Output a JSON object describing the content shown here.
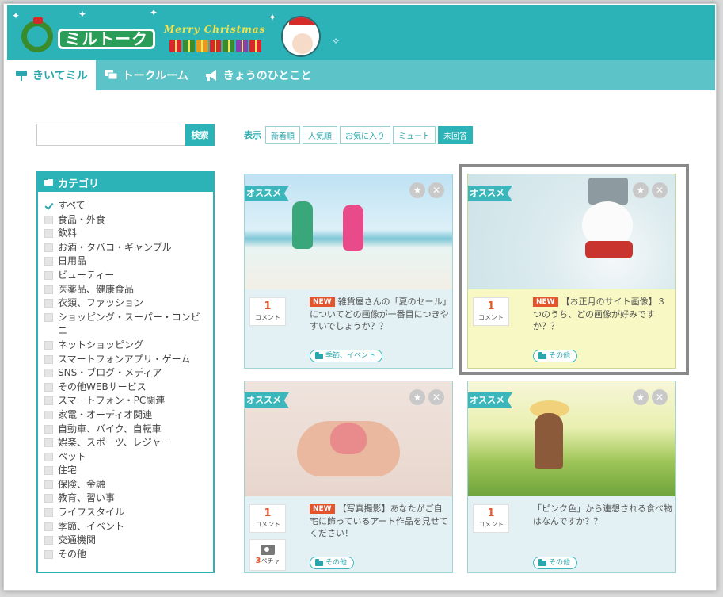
{
  "header": {
    "logo_text": "ミルトーク",
    "banner_text": "Merry Christmas"
  },
  "nav": {
    "tabs": [
      {
        "label": "きいてミル",
        "icon": "pin-icon",
        "active": true
      },
      {
        "label": "トークルーム",
        "icon": "chat-icon",
        "active": false
      },
      {
        "label": "きょうのひとこと",
        "icon": "megaphone-icon",
        "active": false
      }
    ]
  },
  "search": {
    "placeholder": "",
    "button_label": "検索"
  },
  "category": {
    "title": "カテゴリ",
    "items": [
      {
        "label": "すべて",
        "checked": true
      },
      {
        "label": "食品・外食",
        "checked": false
      },
      {
        "label": "飲料",
        "checked": false
      },
      {
        "label": "お酒・タバコ・ギャンブル",
        "checked": false
      },
      {
        "label": "日用品",
        "checked": false
      },
      {
        "label": "ビューティー",
        "checked": false
      },
      {
        "label": "医薬品、健康食品",
        "checked": false
      },
      {
        "label": "衣類、ファッション",
        "checked": false
      },
      {
        "label": "ショッピング・スーパー・コンビニ",
        "checked": false
      },
      {
        "label": "ネットショッピング",
        "checked": false
      },
      {
        "label": "スマートフォンアプリ・ゲーム",
        "checked": false
      },
      {
        "label": "SNS・ブログ・メディア",
        "checked": false
      },
      {
        "label": "その他WEBサービス",
        "checked": false
      },
      {
        "label": "スマートフォン・PC関連",
        "checked": false
      },
      {
        "label": "家電・オーディオ関連",
        "checked": false
      },
      {
        "label": "自動車、バイク、自転車",
        "checked": false
      },
      {
        "label": "娯楽、スポーツ、レジャー",
        "checked": false
      },
      {
        "label": "ペット",
        "checked": false
      },
      {
        "label": "住宅",
        "checked": false
      },
      {
        "label": "保険、金融",
        "checked": false
      },
      {
        "label": "教育、習い事",
        "checked": false
      },
      {
        "label": "ライフスタイル",
        "checked": false
      },
      {
        "label": "季節、イベント",
        "checked": false
      },
      {
        "label": "交通機関",
        "checked": false
      },
      {
        "label": "その他",
        "checked": false
      }
    ]
  },
  "filter": {
    "label": "表示",
    "buttons": [
      {
        "label": "新着順",
        "active": false
      },
      {
        "label": "人気順",
        "active": false
      },
      {
        "label": "お気に入り",
        "active": false
      },
      {
        "label": "ミュート",
        "active": false
      },
      {
        "label": "未回答",
        "active": true
      }
    ]
  },
  "cards": [
    {
      "ribbon": "オススメ",
      "comment_count": "1",
      "comment_label": "コメント",
      "is_new": true,
      "new_label": "NEW",
      "title": "雑貨屋さんの「夏のセール」についてどの画像が一番目につきやすいでしょうか？？",
      "tag": "季節、イベント",
      "image": "beach-jump-photo",
      "highlighted": false
    },
    {
      "ribbon": "オススメ",
      "comment_count": "1",
      "comment_label": "コメント",
      "is_new": true,
      "new_label": "NEW",
      "title": "【お正月のサイト画像】３つのうち、どの画像が好みですか？？",
      "tag": "その他",
      "image": "snowman-photo",
      "highlighted": true
    },
    {
      "ribbon": "オススメ",
      "comment_count": "1",
      "comment_label": "コメント",
      "is_new": true,
      "new_label": "NEW",
      "title": "【写真撮影】あなたがご自宅に飾っているアート作品を見せてください！",
      "tag": "その他",
      "image": "hands-heart-photo",
      "photo_count": "3",
      "photo_label": "ペチャ",
      "highlighted": false
    },
    {
      "ribbon": "オススメ",
      "comment_count": "1",
      "comment_label": "コメント",
      "is_new": false,
      "new_label": "",
      "title": "「ピンク色」から連想される食べ物はなんですか？？",
      "tag": "その他",
      "image": "field-girl-photo",
      "highlighted": false
    }
  ],
  "colors": {
    "brand": "#2bb3b8",
    "new_badge": "#e3542b",
    "highlight": "#f8f8c4"
  }
}
